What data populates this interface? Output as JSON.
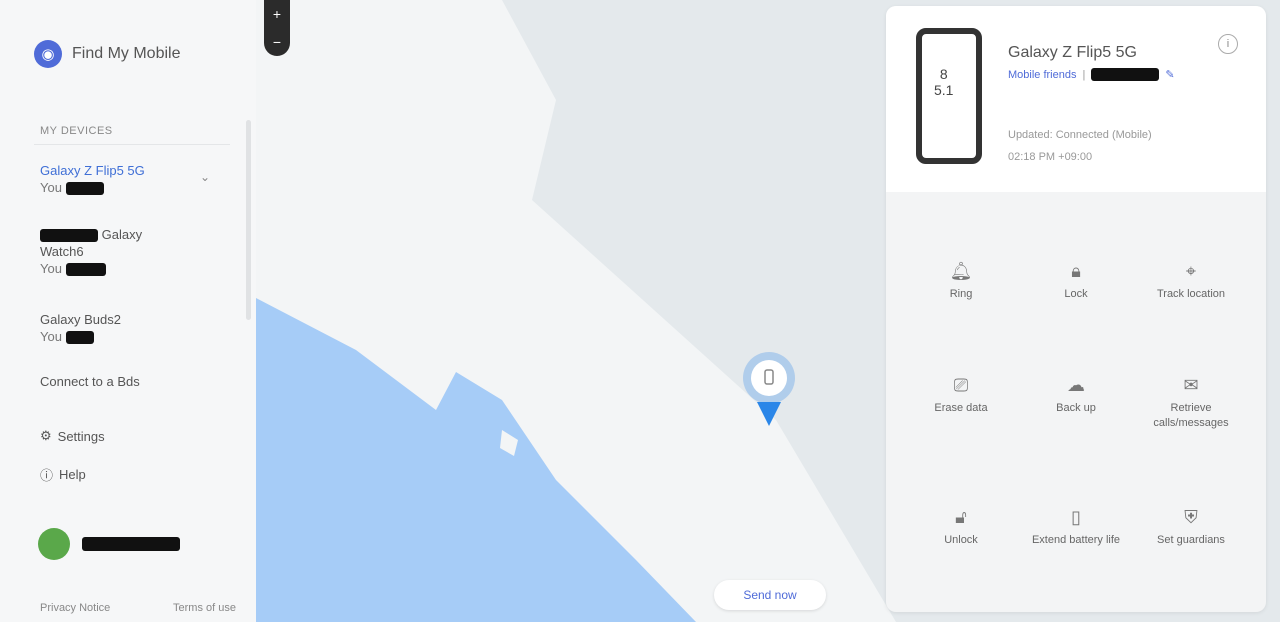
{
  "brand": {
    "name": "Find My Mobile",
    "icon": "location-logo-icon"
  },
  "sidebar": {
    "section_label": "MY DEVICES",
    "devices": [
      {
        "title": "Galaxy Z Flip5 5G",
        "sub_prefix": "You",
        "redacted": true
      },
      {
        "title_suffix": "Galaxy",
        "title_line2": "Watch6",
        "sub_prefix": "You",
        "redacted": true
      },
      {
        "title": "Galaxy Buds2",
        "sub_prefix": "You",
        "redacted": true
      }
    ],
    "find_others": "Connect to a Bds",
    "menu": [
      {
        "label": "Settings",
        "icon": "gear-icon"
      },
      {
        "label": "Help",
        "icon": "help-icon"
      }
    ],
    "footer": {
      "left": "Privacy Notice",
      "right": "Terms of use"
    }
  },
  "map": {
    "zoom_in": "+",
    "zoom_out": "−",
    "pill_label": "Send now",
    "colors": {
      "land": "#e4e9ec",
      "coast": "#f3f5f6",
      "water": "#a6ccf7",
      "pin": "#2a86e8"
    }
  },
  "panel": {
    "device_name": "Galaxy Z Flip5 5G",
    "link_text": "Mobile friends",
    "updated_line1": "Updated: Connected (Mobile)",
    "updated_line2": "02:18 PM +09:00",
    "phone_lines": [
      "8",
      "5.1"
    ],
    "actions": [
      {
        "label": "Ring",
        "icon": "bell-icon"
      },
      {
        "label": "Lock",
        "icon": "lock-icon"
      },
      {
        "label": "Track location",
        "icon": "location-icon"
      },
      {
        "label": "Erase data",
        "icon": "erase-icon"
      },
      {
        "label": "Back up",
        "icon": "cloud-icon"
      },
      {
        "label": "Retrieve calls/messages",
        "icon": "message-icon"
      },
      {
        "label": "Unlock",
        "icon": "unlock-icon"
      },
      {
        "label": "Extend battery life",
        "icon": "battery-icon"
      },
      {
        "label": "Set guardians",
        "icon": "shield-icon"
      }
    ]
  }
}
